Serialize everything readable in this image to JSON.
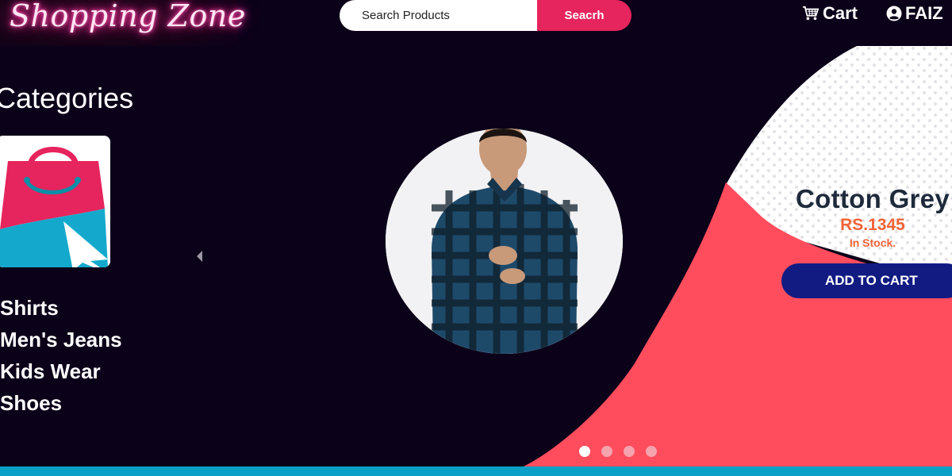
{
  "header": {
    "logo_text": "Shopping Zone",
    "search": {
      "placeholder": "Search Products",
      "button_label": "Seacrh"
    },
    "cart_label": "Cart",
    "user_label": "FAIZ"
  },
  "sidebar": {
    "title": "Categories",
    "items": [
      "Shirts",
      "Men's Jeans",
      "Kids Wear",
      "Shoes"
    ]
  },
  "product": {
    "name": "Cotton Grey",
    "price": "RS.1345",
    "stock": "In Stock.",
    "button_label": "ADD TO CART"
  },
  "carousel": {
    "slide_count": 4,
    "active_index": 0
  },
  "colors": {
    "background": "#0b0119",
    "search_button": "#e6245d",
    "hero_shape": "#ff4d5e",
    "add_to_cart": "#111b82",
    "price": "#f26236",
    "footer_bar": "#0aa0c7"
  },
  "icons": [
    "cart-icon",
    "user-circle-icon",
    "shopping-bag-icon",
    "cursor-arrow-icon",
    "chevron-left-icon"
  ]
}
